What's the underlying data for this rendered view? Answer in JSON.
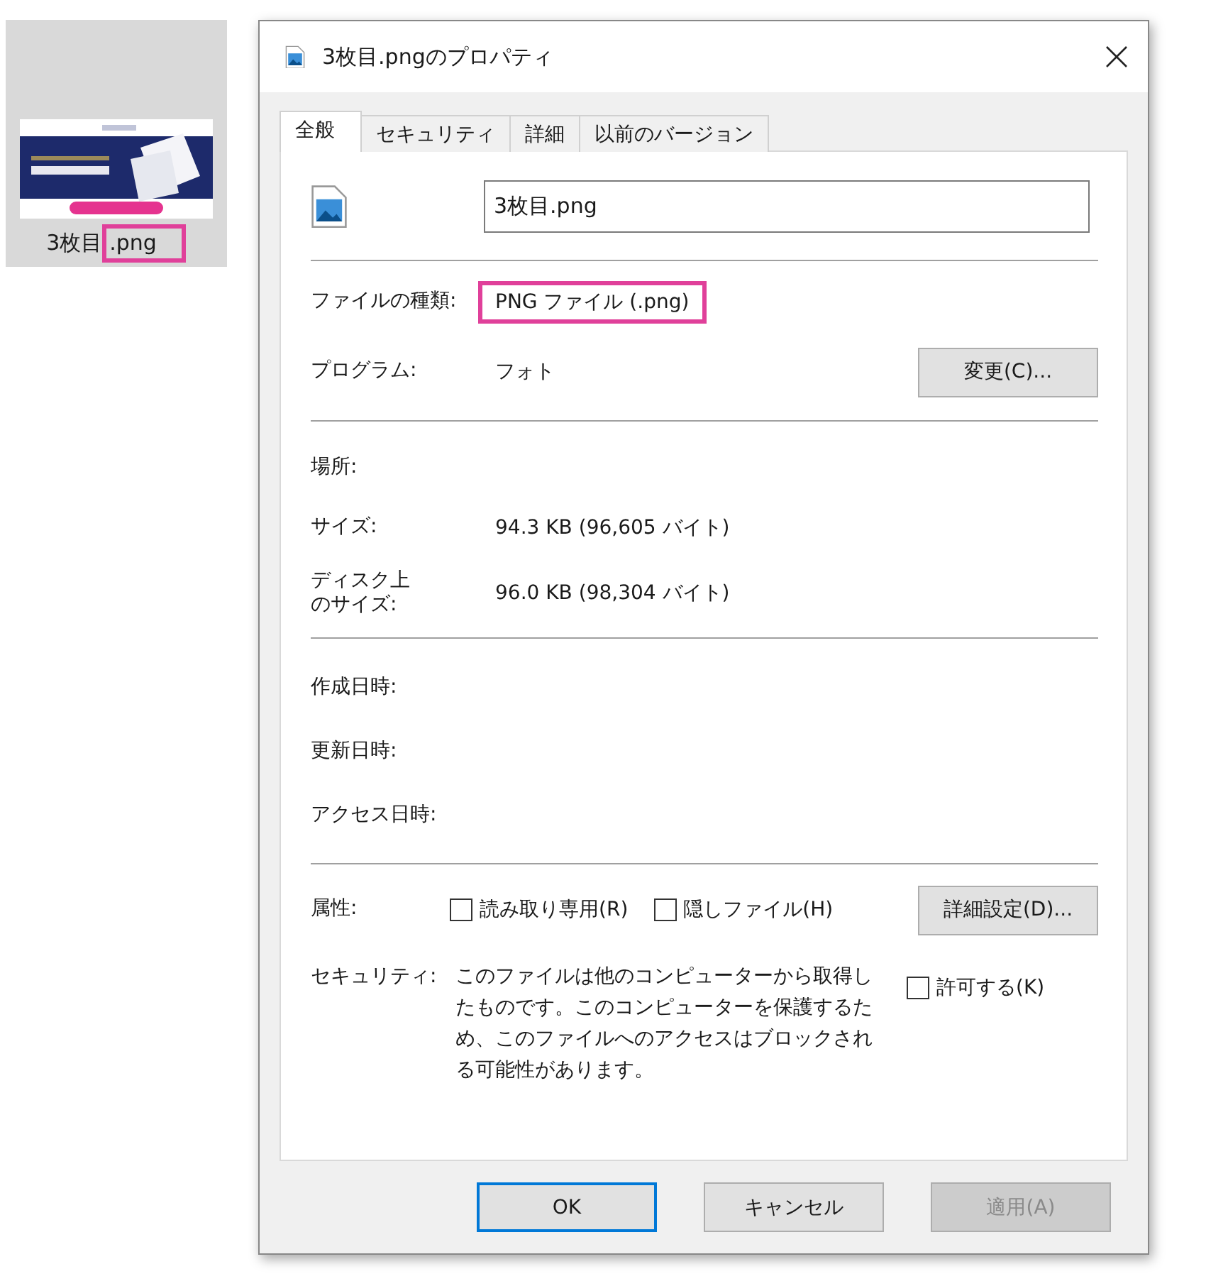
{
  "file_tile": {
    "name": "3枚目",
    "extension": ".png",
    "extension_highlighted": true
  },
  "window": {
    "title": "3枚目.pngのプロパティ"
  },
  "tabs": [
    {
      "label": "全般",
      "selected": true
    },
    {
      "label": "セキュリティ",
      "selected": false
    },
    {
      "label": "詳細",
      "selected": false
    },
    {
      "label": "以前のバージョン",
      "selected": false
    }
  ],
  "general": {
    "file_name": "3枚目.png",
    "type_row": {
      "label": "ファイルの種類:",
      "value": "PNG ファイル (.png)",
      "highlighted": true
    },
    "program_row": {
      "label": "プログラム:",
      "value": "フォト",
      "button": "変更(C)..."
    },
    "size_rows": [
      {
        "label": "場所:"
      },
      {
        "label": "サイズ:",
        "value": "94.3 KB (96,605 バイト)"
      },
      {
        "label": "ディスク上のサイズ:",
        "value": "96.0 KB (98,304 バイト)"
      }
    ],
    "date_rows": [
      {
        "label": "作成日時:"
      },
      {
        "label": "更新日時:"
      },
      {
        "label": "アクセス日時:"
      }
    ],
    "attributes": {
      "label": "属性:",
      "checkboxes": [
        {
          "label": "読み取り専用(R)",
          "checked": false
        },
        {
          "label": "隠しファイル(H)",
          "checked": false
        }
      ],
      "button": "詳細設定(D)..."
    },
    "security": {
      "label": "セキュリティ:",
      "text": "このファイルは他のコンピューターから取得したものです。このコンピューターを保護するため、このファイルへのアクセスはブロックされる可能性があります。",
      "checkbox": {
        "label": "許可する(K)",
        "checked": false
      }
    }
  },
  "buttons": [
    {
      "label": "OK",
      "default": true,
      "disabled": false
    },
    {
      "label": "キャンセル",
      "default": false,
      "disabled": false
    },
    {
      "label": "適用(A)",
      "default": false,
      "disabled": true
    }
  ]
}
